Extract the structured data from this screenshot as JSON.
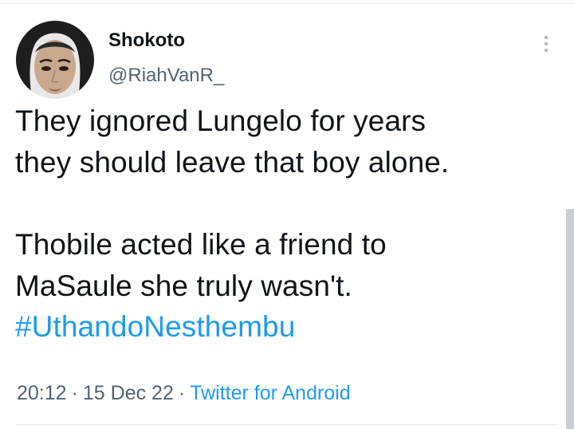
{
  "tweet": {
    "author": {
      "display_name": "Shokoto",
      "handle": "@RiahVanR_"
    },
    "text_lines": [
      "They ignored Lungelo for years",
      "they should leave that boy alone.",
      "",
      "Thobile acted like a friend to",
      "MaSaule she truly wasn't."
    ],
    "hashtag": "#UthandoNesthembu",
    "meta": {
      "time": "20:12",
      "date": "15 Dec 22",
      "separator": "·",
      "source": "Twitter for Android"
    }
  },
  "icons": {
    "more": "more-vertical-icon",
    "avatar": "user-avatar"
  },
  "colors": {
    "text_primary": "#0f1419",
    "text_secondary": "#536471",
    "link": "#1d9bf0",
    "background": "#ffffff"
  }
}
